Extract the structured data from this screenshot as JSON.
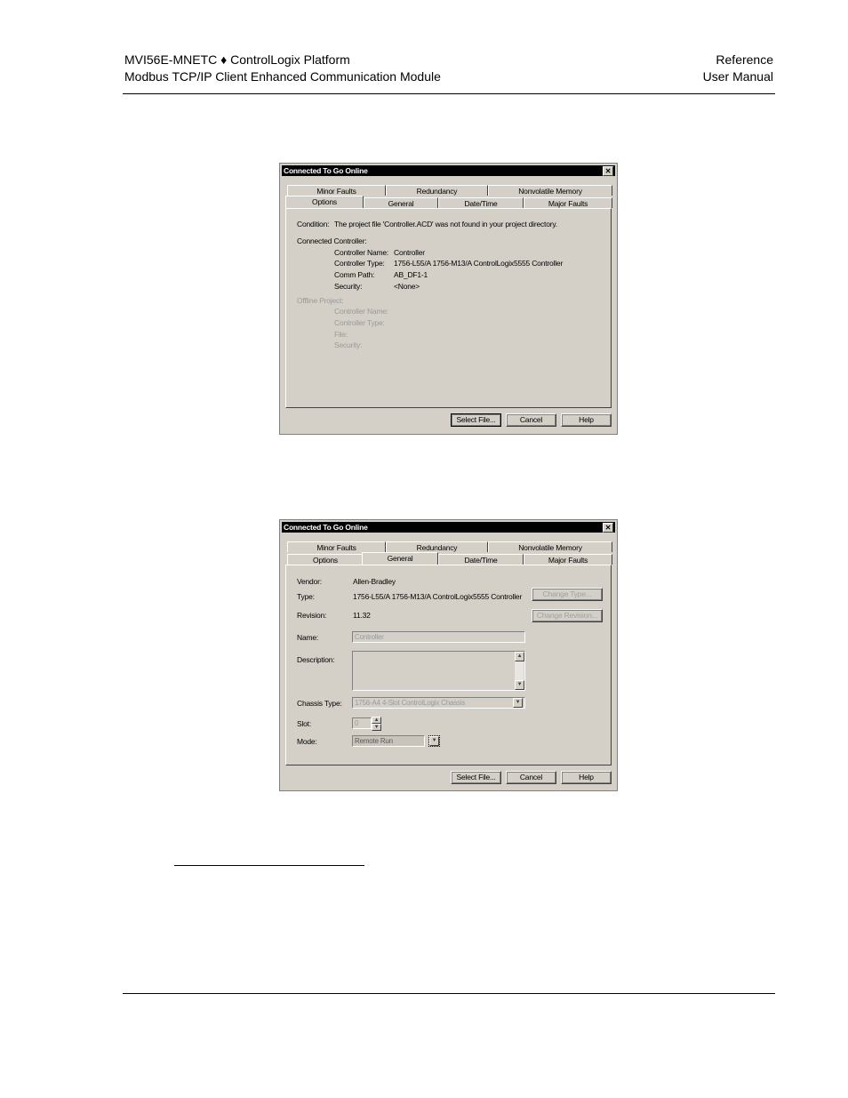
{
  "header": {
    "line1_left": "MVI56E-MNETC ♦ ControlLogix Platform",
    "line2_left": "Modbus TCP/IP Client Enhanced Communication Module",
    "line1_right": "Reference",
    "line2_right": "User Manual"
  },
  "dialog1": {
    "title": "Connected To Go Online",
    "close_glyph": "✕",
    "tabs_back": [
      "Minor Faults",
      "Redundancy",
      "Nonvolatile Memory"
    ],
    "tabs_front": [
      "Options",
      "General",
      "Date/Time",
      "Major Faults"
    ],
    "active_tab": "Options",
    "condition_label": "Condition:",
    "condition_text": "The project file 'Controller.ACD' was not found in your project directory.",
    "connected_heading": "Connected Controller:",
    "connected_labels": [
      "Controller Name:",
      "Controller Type:",
      "Comm Path:",
      "Security:"
    ],
    "connected_values": [
      "Controller",
      "1756-L55/A 1756-M13/A ControlLogix5555 Controller",
      "AB_DF1-1",
      "<None>"
    ],
    "offline_heading": "Offline Project:",
    "offline_labels": [
      "Controller Name:",
      "Controller Type:",
      "File:",
      "Security:"
    ],
    "buttons": [
      "Select File...",
      "Cancel",
      "Help"
    ]
  },
  "dialog2": {
    "title": "Connected To Go Online",
    "close_glyph": "✕",
    "tabs_back": [
      "Minor Faults",
      "Redundancy",
      "Nonvolatile Memory"
    ],
    "tabs_front": [
      "Options",
      "General",
      "Date/Time",
      "Major Faults"
    ],
    "active_tab": "General",
    "vendor_label": "Vendor:",
    "vendor_value": "Allen-Bradley",
    "type_label": "Type:",
    "type_value": "1756-L55/A 1756-M13/A ControlLogix5555 Controller",
    "change_type_button": "Change Type...",
    "revision_label": "Revision:",
    "revision_value": "11.32",
    "change_revision_button": "Change Revision...",
    "name_label": "Name:",
    "name_value": "Controller",
    "description_label": "Description:",
    "description_value": "",
    "chassis_label": "Chassis Type:",
    "chassis_value": "1756-A4    4-Slot ControlLogix Chassis",
    "slot_label": "Slot:",
    "slot_value": "0",
    "mode_label": "Mode:",
    "mode_value": "Remote Run",
    "buttons": [
      "Select File...",
      "Cancel",
      "Help"
    ]
  }
}
